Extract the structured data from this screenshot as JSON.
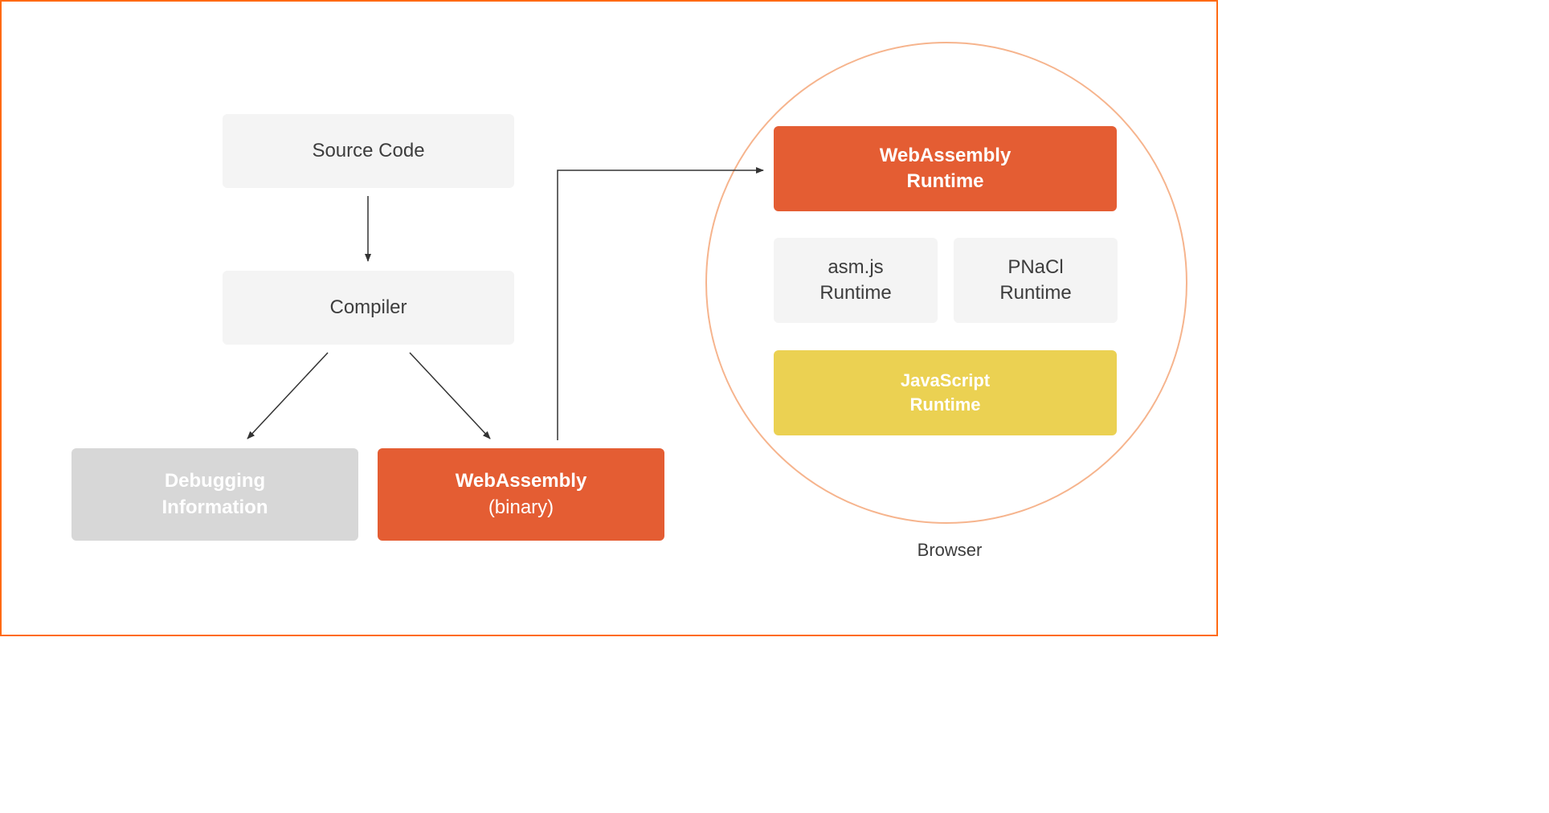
{
  "nodes": {
    "source_code": {
      "label": "Source Code"
    },
    "compiler": {
      "label": "Compiler"
    },
    "debugging_info": {
      "line1": "Debugging",
      "line2": "Information"
    },
    "webassembly": {
      "line1": "WebAssembly",
      "line2": "(binary)"
    },
    "wasm_runtime": {
      "line1": "WebAssembly",
      "line2": "Runtime"
    },
    "asmjs_runtime": {
      "line1": "asm.js",
      "line2": "Runtime"
    },
    "pnacl_runtime": {
      "line1": "PNaCl",
      "line2": "Runtime"
    },
    "js_runtime": {
      "line1": "JavaScript",
      "line2": "Runtime"
    }
  },
  "browser_label": "Browser",
  "colors": {
    "frame_border": "#ff6a13",
    "light_bg": "#f4f4f4",
    "gray_bg": "#d7d7d7",
    "orange_bg": "#e45d33",
    "yellow_bg": "#ebd152",
    "circle_border": "#f6b48d",
    "text_dark": "#3d3d3d",
    "text_light": "#ffffff",
    "arrow": "#333333"
  },
  "arrows": [
    {
      "from": "source_code",
      "to": "compiler"
    },
    {
      "from": "compiler",
      "to": "debugging_info"
    },
    {
      "from": "compiler",
      "to": "webassembly"
    },
    {
      "from": "webassembly",
      "to": "wasm_runtime",
      "shape": "up-right"
    }
  ]
}
